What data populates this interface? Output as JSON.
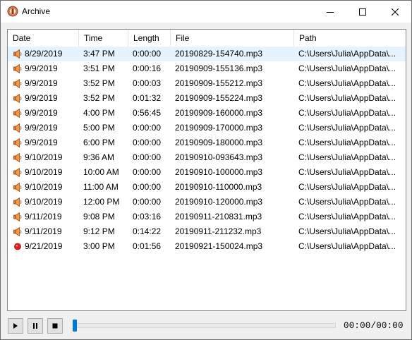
{
  "window": {
    "title": "Archive"
  },
  "columns": [
    "Date",
    "Time",
    "Length",
    "File",
    "Path"
  ],
  "rows": [
    {
      "date": "8/29/2019",
      "time": "3:47 PM",
      "length": "0:00:00",
      "file": "20190829-154740.mp3",
      "path": "C:\\Users\\Julia\\AppData\\...",
      "icon": "speaker-icon",
      "selected": true
    },
    {
      "date": "9/9/2019",
      "time": "3:51 PM",
      "length": "0:00:16",
      "file": "20190909-155136.mp3",
      "path": "C:\\Users\\Julia\\AppData\\...",
      "icon": "speaker-icon"
    },
    {
      "date": "9/9/2019",
      "time": "3:52 PM",
      "length": "0:00:03",
      "file": "20190909-155212.mp3",
      "path": "C:\\Users\\Julia\\AppData\\...",
      "icon": "speaker-icon"
    },
    {
      "date": "9/9/2019",
      "time": "3:52 PM",
      "length": "0:01:32",
      "file": "20190909-155224.mp3",
      "path": "C:\\Users\\Julia\\AppData\\...",
      "icon": "speaker-icon"
    },
    {
      "date": "9/9/2019",
      "time": "4:00 PM",
      "length": "0:56:45",
      "file": "20190909-160000.mp3",
      "path": "C:\\Users\\Julia\\AppData\\...",
      "icon": "speaker-icon"
    },
    {
      "date": "9/9/2019",
      "time": "5:00 PM",
      "length": "0:00:00",
      "file": "20190909-170000.mp3",
      "path": "C:\\Users\\Julia\\AppData\\...",
      "icon": "speaker-icon"
    },
    {
      "date": "9/9/2019",
      "time": "6:00 PM",
      "length": "0:00:00",
      "file": "20190909-180000.mp3",
      "path": "C:\\Users\\Julia\\AppData\\...",
      "icon": "speaker-icon"
    },
    {
      "date": "9/10/2019",
      "time": "9:36 AM",
      "length": "0:00:00",
      "file": "20190910-093643.mp3",
      "path": "C:\\Users\\Julia\\AppData\\...",
      "icon": "speaker-icon"
    },
    {
      "date": "9/10/2019",
      "time": "10:00 AM",
      "length": "0:00:00",
      "file": "20190910-100000.mp3",
      "path": "C:\\Users\\Julia\\AppData\\...",
      "icon": "speaker-icon"
    },
    {
      "date": "9/10/2019",
      "time": "11:00 AM",
      "length": "0:00:00",
      "file": "20190910-110000.mp3",
      "path": "C:\\Users\\Julia\\AppData\\...",
      "icon": "speaker-icon"
    },
    {
      "date": "9/10/2019",
      "time": "12:00 PM",
      "length": "0:00:00",
      "file": "20190910-120000.mp3",
      "path": "C:\\Users\\Julia\\AppData\\...",
      "icon": "speaker-icon"
    },
    {
      "date": "9/11/2019",
      "time": "9:08 PM",
      "length": "0:03:16",
      "file": "20190911-210831.mp3",
      "path": "C:\\Users\\Julia\\AppData\\...",
      "icon": "speaker-icon"
    },
    {
      "date": "9/11/2019",
      "time": "9:12 PM",
      "length": "0:14:22",
      "file": "20190911-211232.mp3",
      "path": "C:\\Users\\Julia\\AppData\\...",
      "icon": "speaker-icon"
    },
    {
      "date": "9/21/2019",
      "time": "3:00 PM",
      "length": "0:01:56",
      "file": "20190921-150024.mp3",
      "path": "C:\\Users\\Julia\\AppData\\...",
      "icon": "record-icon"
    }
  ],
  "player": {
    "time": "00:00/00:00",
    "progress": 0
  },
  "colors": {
    "selection": "#e5f3ff",
    "accent": "#0078d7",
    "speaker": "#e07a2e",
    "record": "#e02020"
  }
}
